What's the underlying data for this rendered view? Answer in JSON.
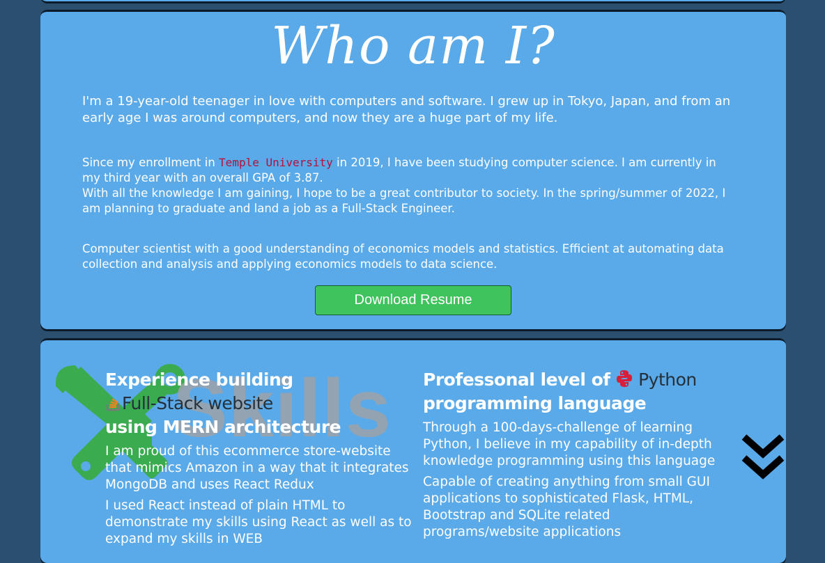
{
  "about": {
    "title": "Who am I?",
    "p1": "I'm a 19-year-old teenager in love with computers and software. I grew up in Tokyo, Japan, and from an early age I was around computers, and now they are a huge part of my life.",
    "p2_before": "Since my enrollment in ",
    "university": "Temple University",
    "p2_after": " in 2019, I have been studying computer science. I am currently in my third year with an overall GPA of 3.87.",
    "p2_line2": "With all the knowledge I am gaining, I hope to be a great contributor to society. In the spring/summer of 2022, I am planning to graduate and land a job as a Full-Stack Engineer.",
    "p3": "Computer scientist with a good understanding of economics models and statistics. Efficient at automating data collection and analysis and applying economics models to data science.",
    "resume_button": "Download Resume"
  },
  "skills": {
    "watermark": "Skills",
    "left": {
      "heading_line1": "Experience building",
      "heading_line2": "Full-Stack website",
      "heading_line3": "using MERN architecture",
      "text1": "I am proud of this ecommerce store-website that mimics Amazon in a way that it integrates MongoDB and uses React Redux",
      "text2": "I used React instead of plain HTML to demonstrate my skills using React as well as to expand my skills in WEB"
    },
    "right": {
      "heading_part1": "Professonal level of",
      "heading_python": "Python",
      "heading_line2": "programming language",
      "text1": "Through a 100-days-challenge of learning Python, I believe in my capability of in-depth knowledge programming using this language",
      "text2": "Capable of creating anything from small GUI applications to sophisticated Flask, HTML, Bootstrap and SQLite related programs/website applications"
    }
  },
  "icons": {
    "stack": "stackoverflow-icon",
    "python": "python-logo-icon",
    "scroll": "double-chevron-down-icon",
    "tools": "wrench-screwdriver-icon"
  },
  "colors": {
    "background": "#2b4f6e",
    "card": "#5aa9e8",
    "button": "#3fc35d",
    "university": "#b3123a"
  }
}
